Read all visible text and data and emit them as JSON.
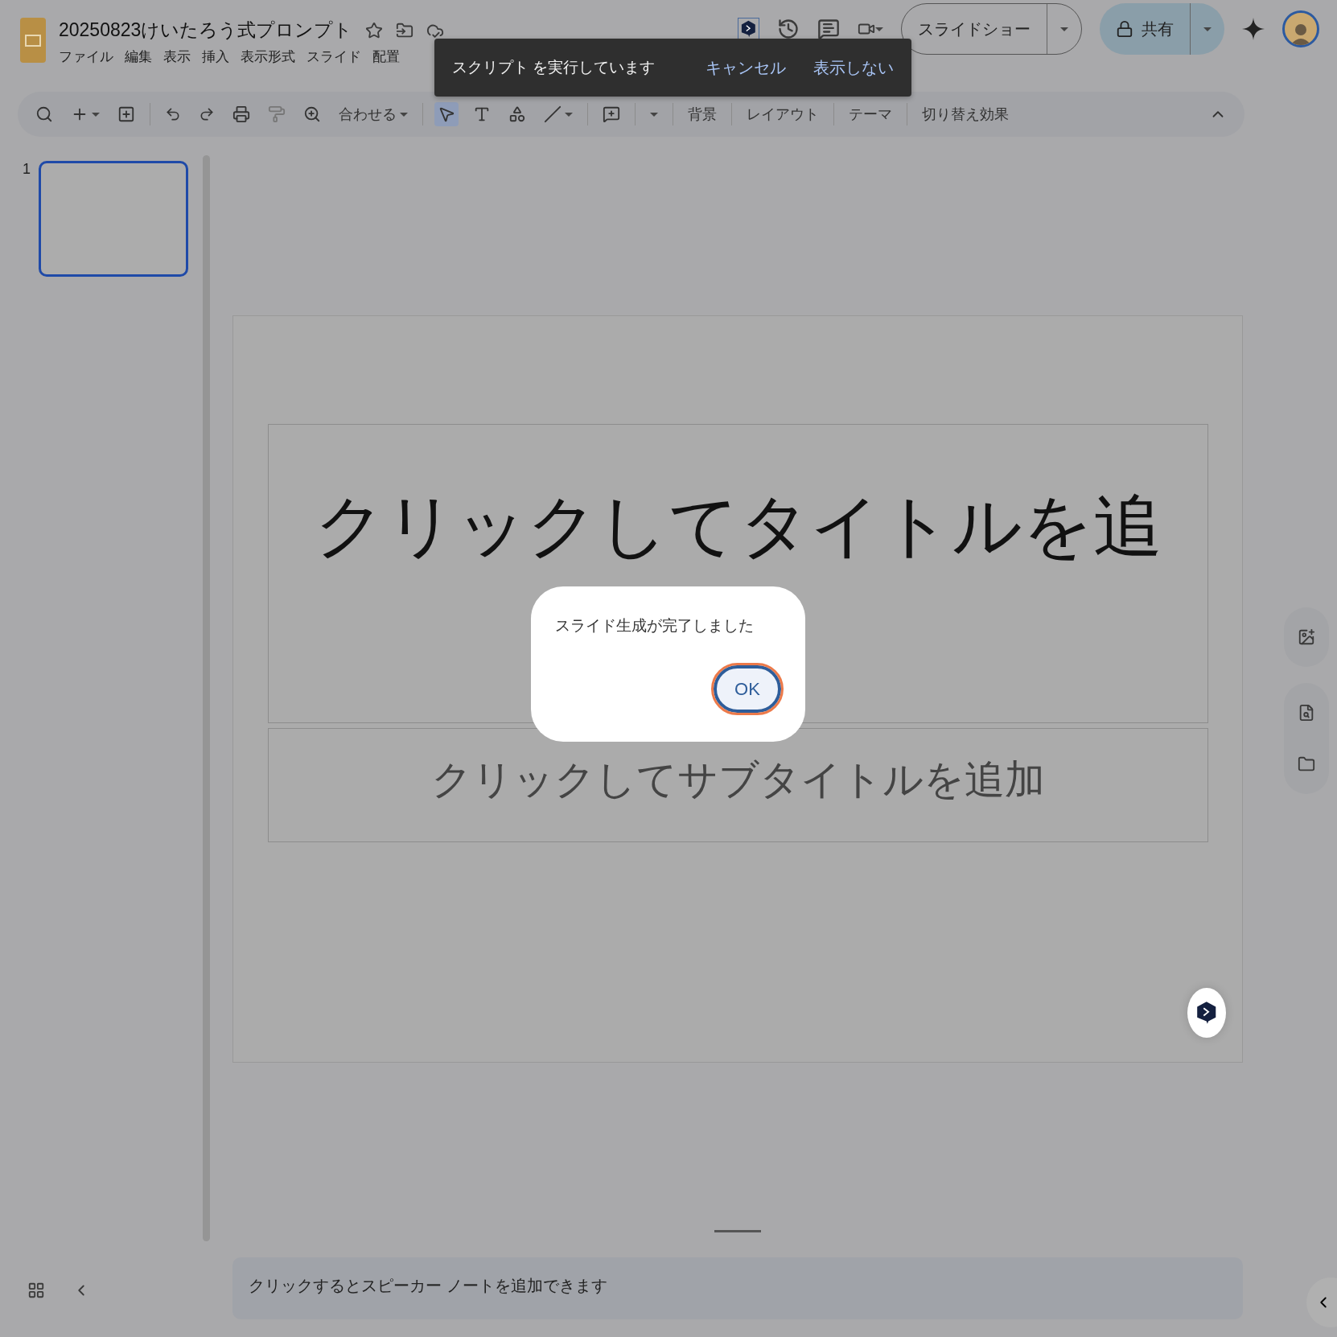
{
  "document": {
    "title": "20250823けいたろう式プロンプト"
  },
  "menu": [
    "ファイル",
    "編集",
    "表示",
    "挿入",
    "表示形式",
    "スライド",
    "配置"
  ],
  "toolbar": {
    "zoom_label": "合わせる",
    "labels": [
      "背景",
      "レイアウト",
      "テーマ",
      "切り替え効果"
    ]
  },
  "slideshow_button": "スライドショー",
  "share_button": "共有",
  "filmstrip": [
    {
      "number": "1",
      "selected": true
    }
  ],
  "slide": {
    "title": "クリックしてタイトルを追",
    "subtitle": "クリックしてサブタイトルを追加"
  },
  "speaker_notes": {
    "placeholder": "クリックするとスピーカー ノートを追加できます"
  },
  "snackbar": {
    "message": "スクリプト を実行しています",
    "actions": [
      "キャンセル",
      "表示しない"
    ]
  },
  "dialog": {
    "message": "スライド生成が完了しました",
    "button": "OK"
  }
}
